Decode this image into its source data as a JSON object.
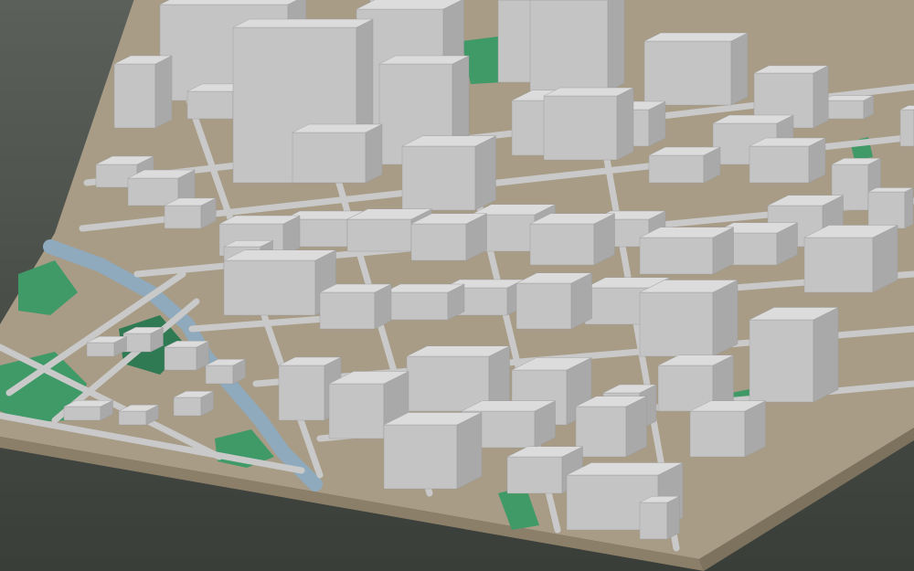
{
  "scene": {
    "description_visible_text": "",
    "colors": {
      "background_top": "#5c605b",
      "background_bottom": "#3a3e39",
      "base_top": "#a89c86",
      "base_side": "#8b7f69",
      "base_side_dark": "#7d725e",
      "road": "#c9c9c9",
      "park": "#3f9a67",
      "park_dark": "#2f7a52",
      "water": "#8fa9bd",
      "building_top": "#dcdcdc",
      "building_left": "#a9a9a9",
      "building_right": "#c4c4c4"
    }
  }
}
